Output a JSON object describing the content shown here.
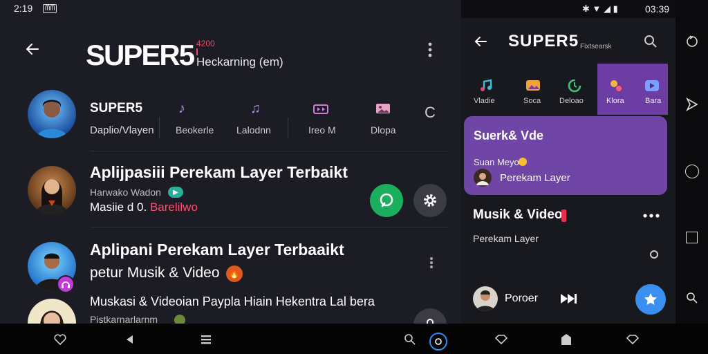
{
  "left": {
    "status": {
      "time": "2:19",
      "badge": "ᗰᗰ"
    },
    "header": {
      "logo": "SUPER5",
      "logo_tag": "4200",
      "subtitle": "Heckarning (em)"
    },
    "profile": {
      "name": "SUPER5",
      "caption": "Daplio/Vlayen",
      "tabs": [
        {
          "icon": "♪",
          "label": "Beokerle"
        },
        {
          "icon": "♫",
          "label": "Lalodnn"
        },
        {
          "icon": "🎞",
          "label": "Ireo M"
        },
        {
          "icon": "🖼",
          "label": "Dlopa"
        },
        {
          "icon": "C",
          "label": ""
        }
      ]
    },
    "items": [
      {
        "title": "Aplijpasiii Perekam Layer Terbaikt",
        "sub1": "Harwako Wadon",
        "sub2a": "Masiie d 0.",
        "sub2b": "Barelilwo"
      },
      {
        "title": "Aplipani Perekam Layer Terbaaikt",
        "sub1": "petur Musik & Video"
      },
      {
        "title": "Muskasi & Videoian Paypla Hiain Hekentra Lal bera",
        "sub1": "Pistkarnarlarnm"
      }
    ]
  },
  "right": {
    "status": {
      "time": "03:39"
    },
    "header": {
      "title": "SUPER5",
      "tag": "Fixtsearsk"
    },
    "tabs": [
      {
        "label": "Vladie",
        "color": "#36c3d9"
      },
      {
        "label": "Soca",
        "color": "#f0a33a"
      },
      {
        "label": "Deloao",
        "color": "#43c07a"
      },
      {
        "label": "Klora",
        "color": "#f5b63b"
      },
      {
        "label": "Bara",
        "color": "#7aa0ff"
      }
    ],
    "card": {
      "title": "Suerk& Vde",
      "sub": "Suan Meyo",
      "footer": "Perekam Layer"
    },
    "section": {
      "title": "Musik & Video",
      "sub": "Perekam Layer"
    },
    "player": {
      "name": "Poroer"
    }
  }
}
